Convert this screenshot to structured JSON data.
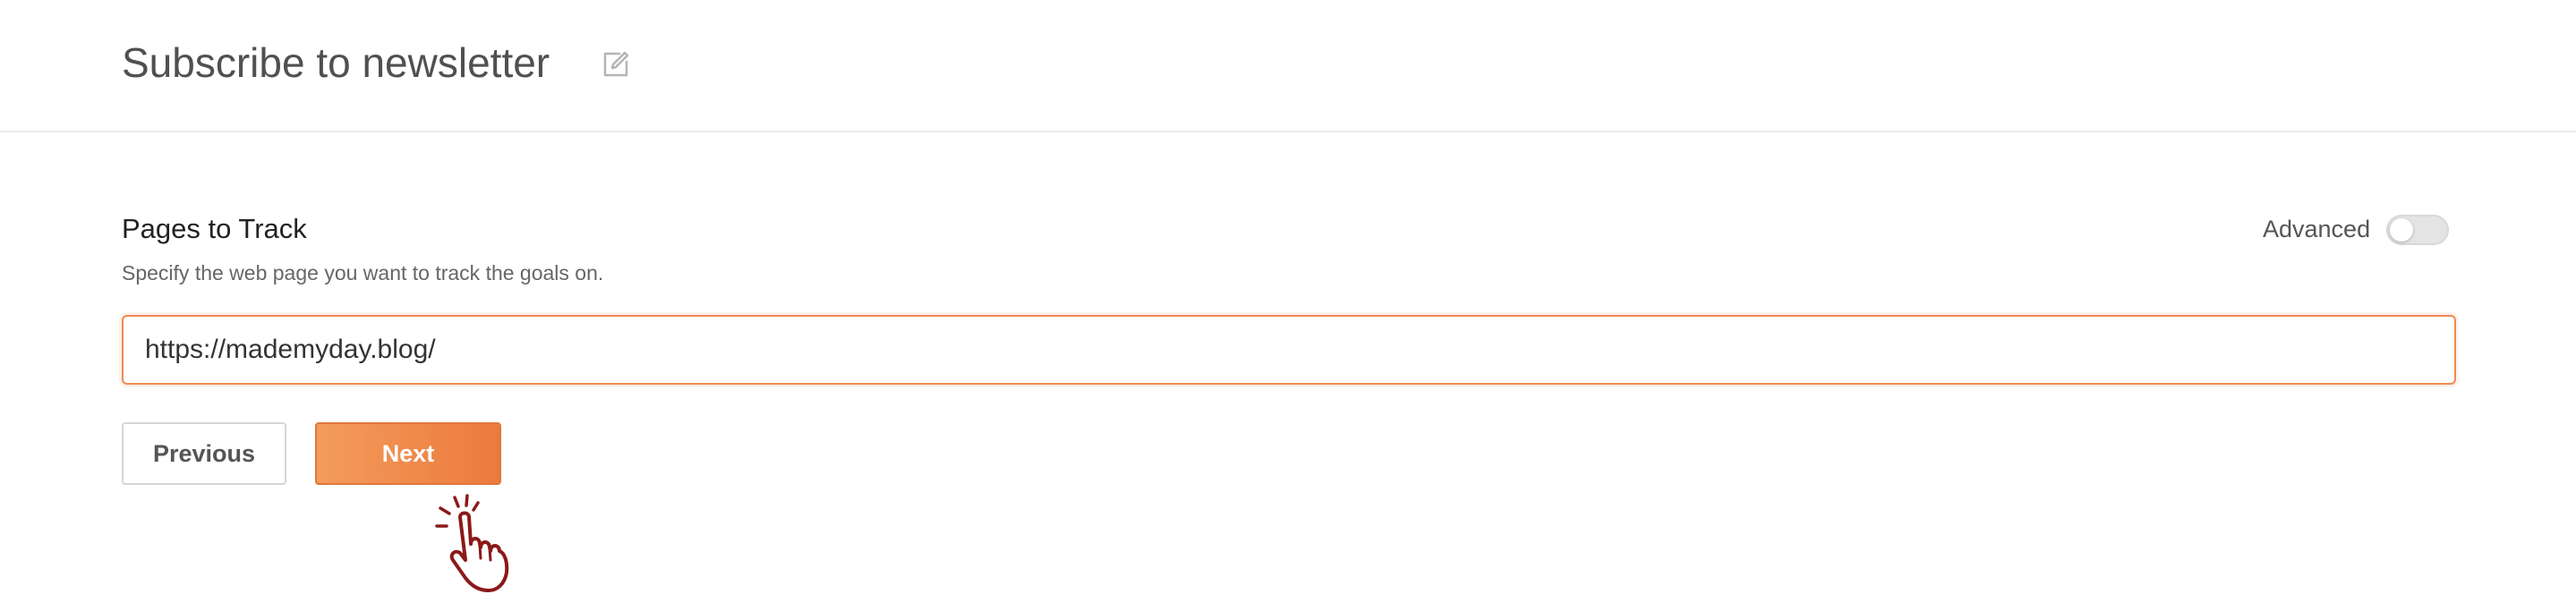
{
  "header": {
    "title": "Subscribe to newsletter",
    "edit_icon": "edit-icon"
  },
  "pages_section": {
    "title": "Pages to Track",
    "description": "Specify the web page you want to track the goals on.",
    "advanced_label": "Advanced",
    "advanced_enabled": false,
    "url_value": "https://mademyday.blog/"
  },
  "actions": {
    "previous_label": "Previous",
    "next_label": "Next"
  },
  "colors": {
    "accent": "#EF8A52",
    "accent_dark": "#E2773C",
    "title_text": "#505050",
    "cursor": "#8B1A1A"
  },
  "overlay": {
    "cursor_icon": "hand-pointer-click-icon"
  }
}
